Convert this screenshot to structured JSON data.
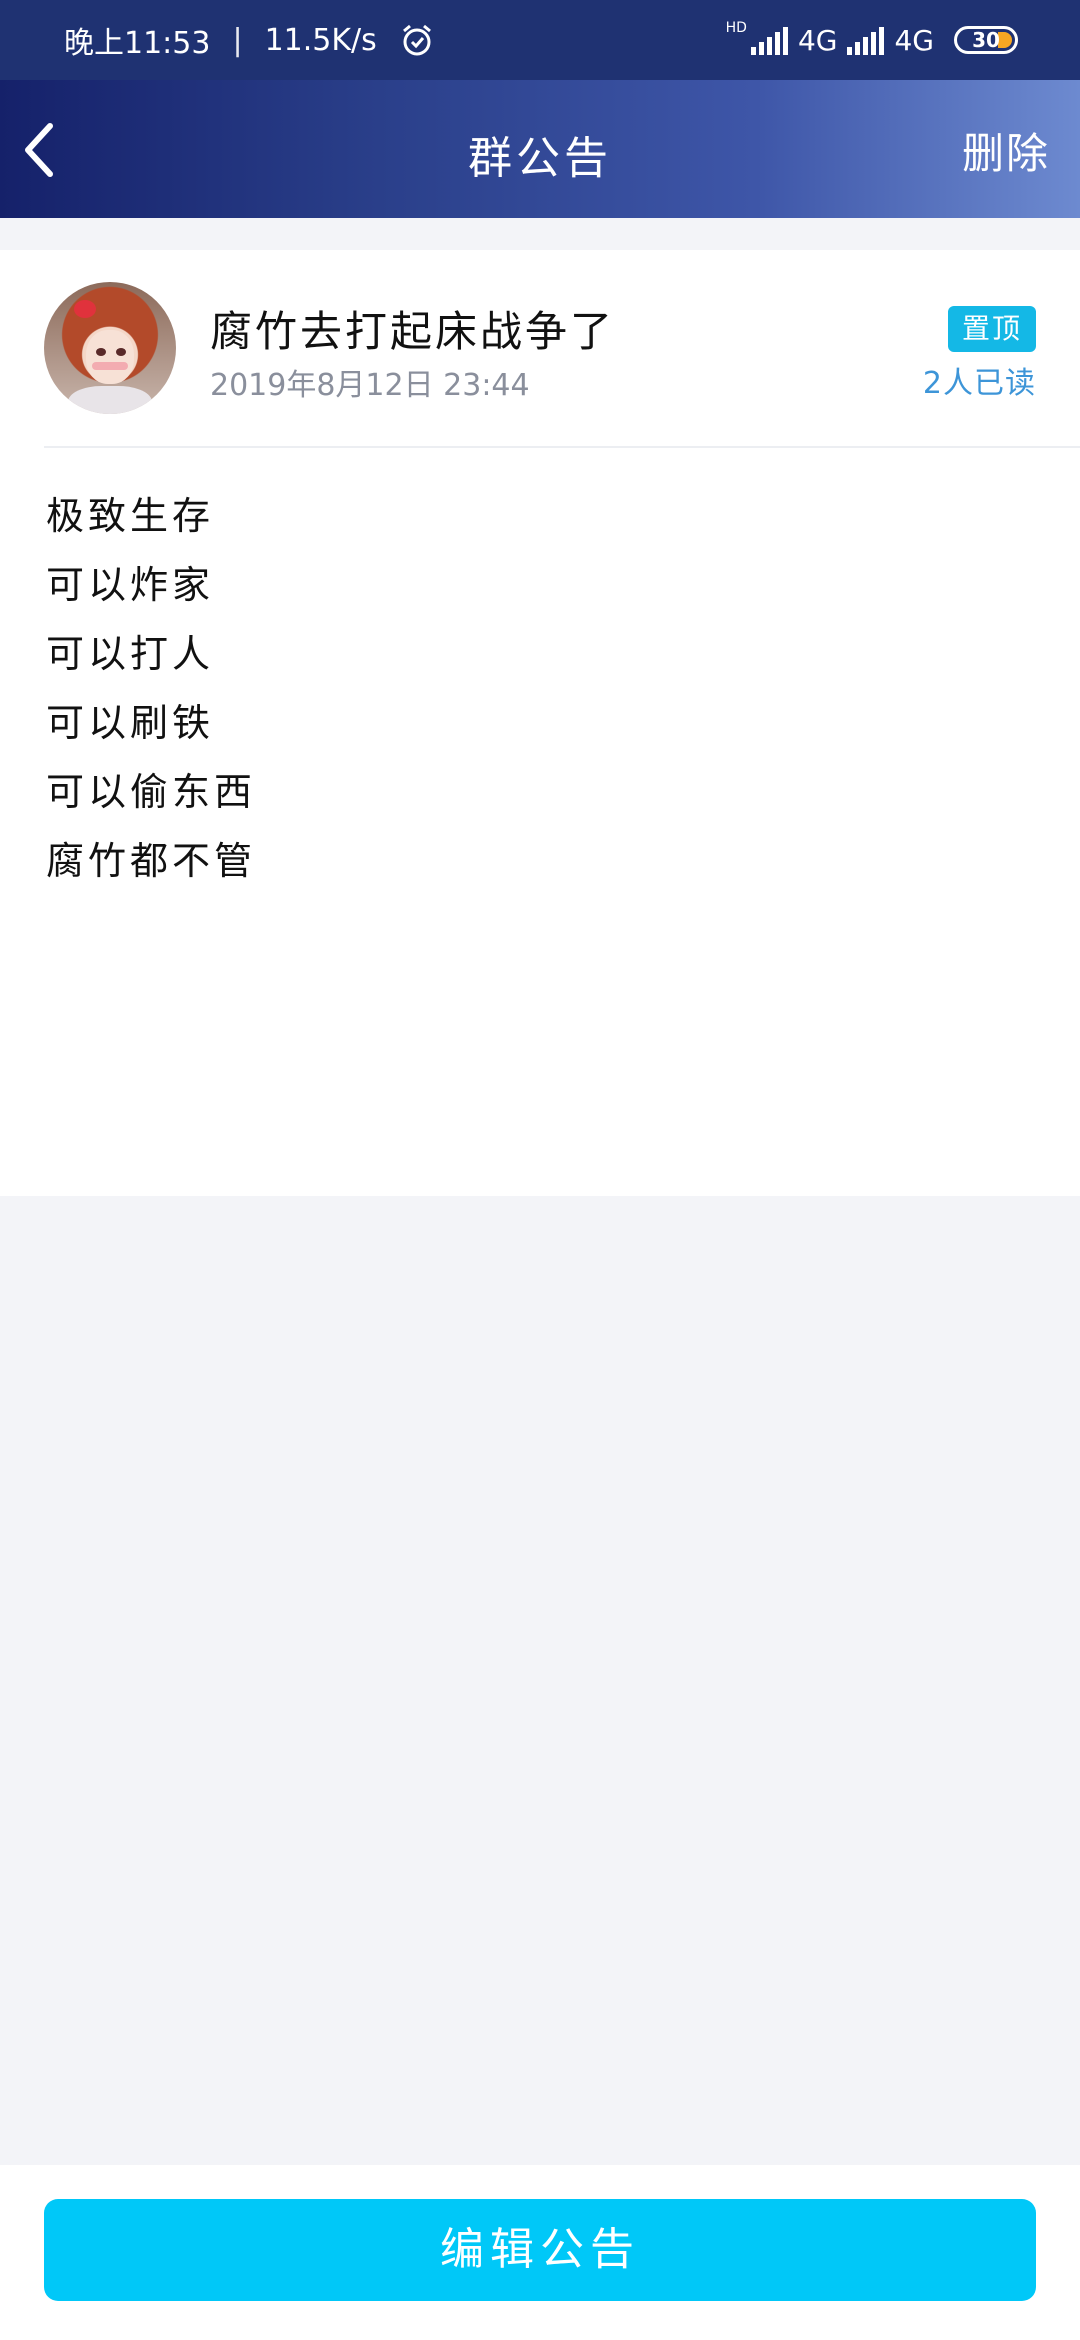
{
  "status_bar": {
    "time": "晚上11:53",
    "separator": "|",
    "net_speed": "11.5K/s",
    "hd_label": "HD",
    "network1": "4G",
    "network2": "4G",
    "battery": "30",
    "alarm_icon": "alarm-clock-icon",
    "signal_icon": "signal-bars-icon",
    "battery_accent": "#f5a623"
  },
  "header": {
    "back_icon": "chevron-left-icon",
    "title": "群公告",
    "delete_label": "删除",
    "gradient": [
      "#15216a",
      "#6d8ad0"
    ]
  },
  "notice": {
    "author": "腐竹去打起床战争了",
    "time": "2019年8月12日 23:44",
    "pinned_label": "置顶",
    "read_count": "2人已读",
    "lines": [
      "极致生存",
      "可以炸家",
      "可以打人",
      "可以刷铁",
      "可以偷东西",
      "腐竹都不管"
    ],
    "badge_color": "#14b8e6",
    "read_color": "#3d95d8"
  },
  "footer": {
    "edit_label": "编辑公告",
    "button_color": "#00c8f8"
  }
}
